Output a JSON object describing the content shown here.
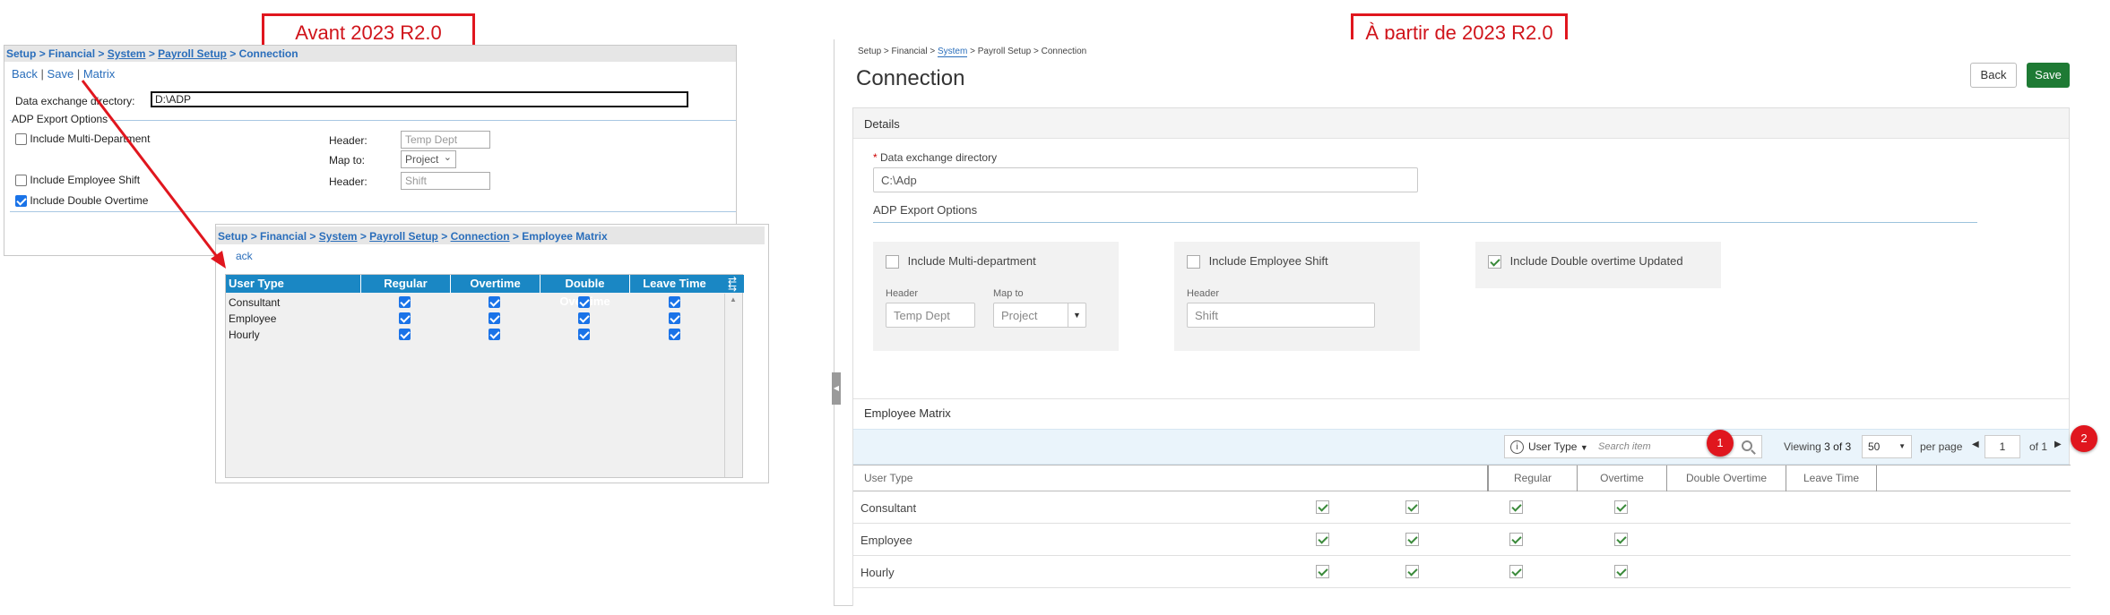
{
  "labels": {
    "before": "Avant 2023 R2.0",
    "after": "À partir de 2023 R2.0"
  },
  "old_ui": {
    "breadcrumb": {
      "setup": "Setup",
      "sep": ">",
      "financial": "Financial",
      "system": "System",
      "payroll_setup": "Payroll Setup",
      "connection": "Connection"
    },
    "toolbar": {
      "back": "Back",
      "save": "Save",
      "matrix": "Matrix",
      "sep": "|"
    },
    "data_dir_label": "Data exchange directory:",
    "data_dir_value": "D:\\ADP",
    "adp_section": "ADP Export Options",
    "multi_dept": "Include Multi-Department",
    "emp_shift": "Include Employee Shift",
    "double_ot": "Include Double Overtime",
    "header_label": "Header:",
    "map_to_label": "Map to:",
    "header_value1": "Temp Dept",
    "map_to_value": "Project",
    "header_value2": "Shift"
  },
  "old_matrix": {
    "breadcrumb": {
      "setup": "Setup",
      "financial": "Financial",
      "system": "System",
      "payroll_setup": "Payroll Setup",
      "connection": "Connection",
      "current": "Employee Matrix"
    },
    "back": "ack",
    "columns": [
      "User Type",
      "Regular",
      "Overtime",
      "Double Overtime",
      "Leave Time"
    ],
    "rows": [
      {
        "name": "Consultant"
      },
      {
        "name": "Employee"
      },
      {
        "name": "Hourly"
      }
    ]
  },
  "new_ui": {
    "breadcrumb": {
      "setup": "Setup",
      "financial": "Financial",
      "system": "System",
      "payroll_setup": "Payroll Setup",
      "connection": "Connection",
      "sep": ">"
    },
    "title": "Connection",
    "back": "Back",
    "save": "Save",
    "details": "Details",
    "data_dir_label": "Data exchange directory",
    "required_mark": "*",
    "data_dir_value": "C:\\Adp",
    "adp_section": "ADP Export Options",
    "multi_dept": "Include Multi-department",
    "emp_shift": "Include Employee Shift",
    "double_ot": "Include Double overtime Updated",
    "header_label": "Header",
    "map_to_label": "Map to",
    "header_value1": "Temp Dept",
    "map_to_value": "Project",
    "header_value2": "Shift",
    "matrix_title": "Employee Matrix",
    "filter_field": "User Type",
    "search_placeholder": "Search item",
    "badge1": "1",
    "badge2": "2",
    "viewing_pre": "Viewing",
    "viewing_count": "3 of 3",
    "per_page_value": "50",
    "per_page_label": "per page",
    "page_value": "1",
    "of_pages": "of 1",
    "columns": [
      "User Type",
      "Regular",
      "Overtime",
      "Double Overtime",
      "Leave Time"
    ],
    "rows": [
      {
        "name": "Consultant"
      },
      {
        "name": "Employee"
      },
      {
        "name": "Hourly"
      }
    ]
  },
  "colors": {
    "accent_red": "#e0161e",
    "old_header_blue": "#1a87c4",
    "save_green": "#1e7a34"
  }
}
